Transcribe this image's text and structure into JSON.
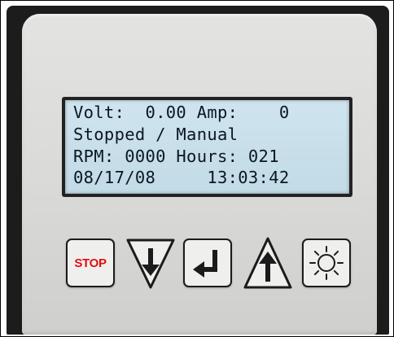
{
  "display": {
    "line1": "Volt:  0.00 Amp:    0",
    "line2": "Stopped / Manual",
    "line3": "RPM: 0000 Hours: 021",
    "line4": "08/17/08     13:03:42"
  },
  "buttons": {
    "stop_label": "STOP",
    "down_icon": "down-arrow-icon",
    "enter_icon": "enter-return-icon",
    "up_icon": "up-arrow-icon",
    "backlight_icon": "sun-brightness-icon"
  },
  "colors": {
    "lcd_background": "#c9e0ea",
    "lcd_text": "#0c1624",
    "stop_text": "#e01010",
    "housing": "#1c1c1c",
    "faceplate": "#dcdcda"
  }
}
